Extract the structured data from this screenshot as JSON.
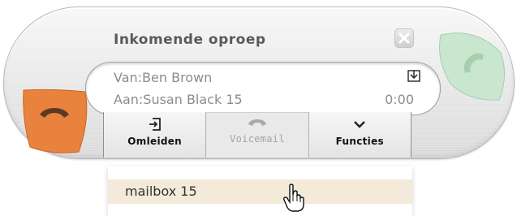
{
  "call": {
    "title": "Inkomende oproep",
    "from": "Van:Ben Brown",
    "to": "Aan:Susan Black 15",
    "duration": "0:00"
  },
  "toolbar": {
    "buttons": [
      {
        "label": "Omleiden",
        "icon": "forward-in-icon",
        "enabled": true
      },
      {
        "label": "Voicemail",
        "icon": "voicemail-icon",
        "enabled": false
      },
      {
        "label": "Functies",
        "icon": "chevron-down-icon",
        "enabled": true
      }
    ]
  },
  "dropdown": {
    "items": [
      {
        "label": "mailbox 15",
        "hovered": true
      }
    ]
  },
  "icons": {
    "answer": "phone-answer-icon",
    "reject": "phone-reject-icon",
    "close": "close-icon",
    "download": "download-icon",
    "cursor": "hand-pointer-icon"
  },
  "colors": {
    "answer_green": "#c9e6cf",
    "reject_orange": "#e8823d",
    "hover_row": "#f3ead9"
  }
}
